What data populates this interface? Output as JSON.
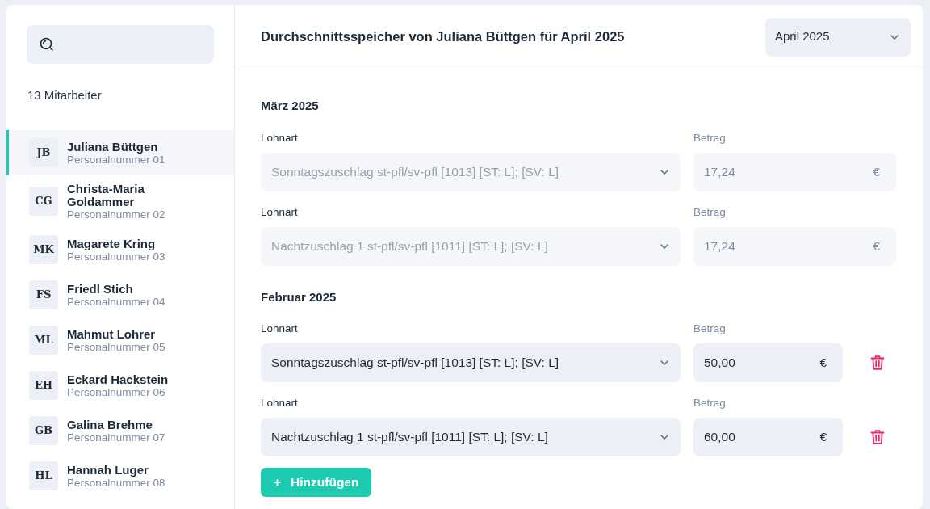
{
  "sidebar": {
    "count": "13 Mitarbeiter",
    "employees": [
      {
        "initials": "JB",
        "name": "Juliana Büttgen",
        "number": "Personalnummer 01",
        "selected": true
      },
      {
        "initials": "CG",
        "name": "Christa-Maria Goldammer",
        "number": "Personalnummer 02",
        "selected": false
      },
      {
        "initials": "MK",
        "name": "Magarete Kring",
        "number": "Personalnummer 03",
        "selected": false
      },
      {
        "initials": "FS",
        "name": "Friedl Stich",
        "number": "Personalnummer 04",
        "selected": false
      },
      {
        "initials": "ML",
        "name": "Mahmut Lohrer",
        "number": "Personalnummer 05",
        "selected": false
      },
      {
        "initials": "EH",
        "name": "Eckard Hackstein",
        "number": "Personalnummer 06",
        "selected": false
      },
      {
        "initials": "GB",
        "name": "Galina Brehme",
        "number": "Personalnummer 07",
        "selected": false
      },
      {
        "initials": "HL",
        "name": "Hannah Luger",
        "number": "Personalnummer 08",
        "selected": false
      }
    ]
  },
  "header": {
    "title": "Durchschnittsspeicher von Juliana Büttgen für April 2025",
    "month_select": "April 2025"
  },
  "groups": [
    {
      "title": "März 2025",
      "entries": [
        {
          "type_label": "Lohnart",
          "type": "Sonntagszuschlag st-pfl/sv-pfl [1013] [ST: L]; [SV: L]",
          "amount_label": "Betrag",
          "amount": "17,24",
          "currency": "€",
          "disabled": true
        },
        {
          "type_label": "Lohnart",
          "type": "Nachtzuschlag 1 st-pfl/sv-pfl [1011] [ST: L]; [SV: L]",
          "amount_label": "Betrag",
          "amount": "17,24",
          "currency": "€",
          "disabled": true
        }
      ]
    },
    {
      "title": "Februar 2025",
      "entries": [
        {
          "type_label": "Lohnart",
          "type": "Sonntagszuschlag st-pfl/sv-pfl [1013] [ST: L]; [SV: L]",
          "amount_label": "Betrag",
          "amount": "50,00",
          "currency": "€",
          "disabled": false
        },
        {
          "type_label": "Lohnart",
          "type": "Nachtzuschlag 1 st-pfl/sv-pfl [1011] [ST: L]; [SV: L]",
          "amount_label": "Betrag",
          "amount": "60,00",
          "currency": "€",
          "disabled": false
        }
      ]
    }
  ],
  "add_button": {
    "icon": "+",
    "label": "Hinzufügen"
  }
}
